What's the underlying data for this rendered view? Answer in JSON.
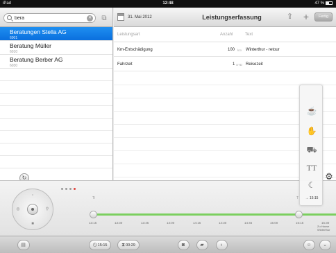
{
  "statusbar": {
    "device": "iPad",
    "time": "12:48",
    "battery": "47 %"
  },
  "search": {
    "value": "bera"
  },
  "clients": [
    {
      "name": "Beratungen Stella AG",
      "code": "6001",
      "selected": true
    },
    {
      "name": "Beratung Müller",
      "code": "6010",
      "selected": false
    },
    {
      "name": "Beratung Berber AG",
      "code": "6030",
      "selected": false
    }
  ],
  "navbar": {
    "date": "31. Mai 2012",
    "title": "Leistungserfassung",
    "done_label": "Fertig"
  },
  "table": {
    "columns": {
      "type": "Leistungsart",
      "count": "Anzahl",
      "text": "Text"
    },
    "rows": [
      {
        "type": "Km-Entschädigung",
        "count": "100",
        "unit": "km",
        "text": "Winterthur - retour"
      },
      {
        "type": "Fahrzeit",
        "count": "1",
        "unit": "STD",
        "text": "Reisezeit"
      }
    ]
  },
  "palette": {
    "items": [
      "coffee-cup-icon",
      "hand-icon",
      "car-icon",
      "font-icon",
      "moon-icon"
    ],
    "time": "→ 15:15"
  },
  "timeline": {
    "label_left": "Ti",
    "label_right": "T",
    "ticks": [
      "13:15",
      "13:30",
      "13:45",
      "14:00",
      "14:15",
      "14:30",
      "14:45",
      "15:00",
      "15:15",
      "15:30"
    ],
    "note": "Zu Hause Winterthur"
  },
  "toolbar": {
    "clock_in": "15:15",
    "duration": "00:29"
  },
  "colors": {
    "selection": "#0a6fde",
    "timeline": "#7bcf5f",
    "indicator": "#e0413a"
  }
}
